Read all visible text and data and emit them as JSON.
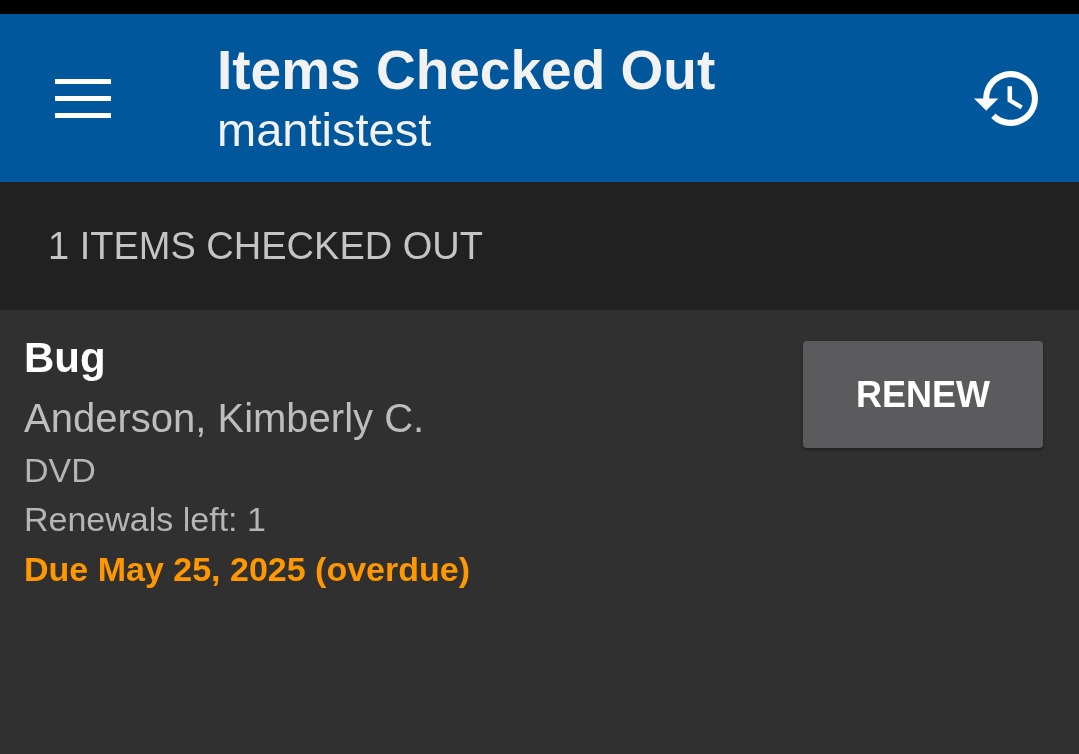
{
  "app_bar": {
    "title": "Items Checked Out",
    "subtitle": "mantistest"
  },
  "section_header": "1 ITEMS CHECKED OUT",
  "items": [
    {
      "title": "Bug",
      "author": "Anderson, Kimberly C.",
      "format": "DVD",
      "renewals": "Renewals left: 1",
      "due": "Due May 25, 2025 (overdue)",
      "overdue": true,
      "button": "RENEW"
    }
  ]
}
